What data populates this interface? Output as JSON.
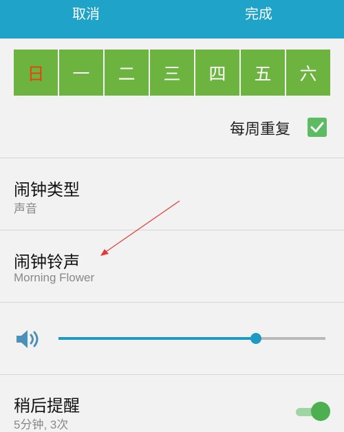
{
  "header": {
    "cancel_label": "取消",
    "done_label": "完成",
    "background_color": "#1fa3c9"
  },
  "days": {
    "items": [
      {
        "label": "日",
        "selected": true
      },
      {
        "label": "一",
        "selected": true
      },
      {
        "label": "二",
        "selected": true
      },
      {
        "label": "三",
        "selected": true
      },
      {
        "label": "四",
        "selected": true
      },
      {
        "label": "五",
        "selected": true
      },
      {
        "label": "六",
        "selected": true
      }
    ],
    "selected_color": "#6db33f",
    "sunday_text_color": "#e8420c"
  },
  "repeat": {
    "label": "每周重复",
    "checked": true,
    "checkbox_icon": "check-icon",
    "color": "#5dbb63"
  },
  "alarm_type": {
    "title": "闹钟类型",
    "value": "声音"
  },
  "ringtone": {
    "title": "闹钟铃声",
    "value": "Morning Flower"
  },
  "volume": {
    "icon": "volume-icon",
    "level_fraction": 0.74,
    "accent_color": "#1c9ac4"
  },
  "snooze": {
    "title": "稍后提醒",
    "value": "5分钟, 3次",
    "enabled": true,
    "toggle_color": "#4caf50"
  },
  "annotation": {
    "type": "red-arrow",
    "color": "#e53935"
  }
}
